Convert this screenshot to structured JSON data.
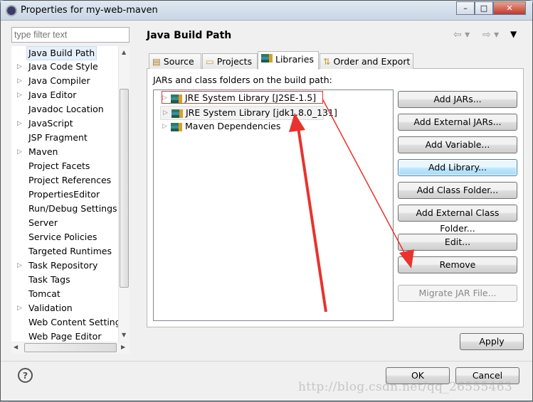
{
  "window": {
    "title": "Properties for my-web-maven",
    "minimize": "–",
    "maximize": "□",
    "close": "✕"
  },
  "sidebar": {
    "filter_placeholder": "type filter text",
    "items": [
      {
        "label": "Java Build Path",
        "expandable": false,
        "selected": true
      },
      {
        "label": "Java Code Style",
        "expandable": true
      },
      {
        "label": "Java Compiler",
        "expandable": true
      },
      {
        "label": "Java Editor",
        "expandable": true
      },
      {
        "label": "Javadoc Location",
        "expandable": false
      },
      {
        "label": "JavaScript",
        "expandable": true
      },
      {
        "label": "JSP Fragment",
        "expandable": false
      },
      {
        "label": "Maven",
        "expandable": true
      },
      {
        "label": "Project Facets",
        "expandable": false
      },
      {
        "label": "Project References",
        "expandable": false
      },
      {
        "label": "PropertiesEditor",
        "expandable": false
      },
      {
        "label": "Run/Debug Settings",
        "expandable": false
      },
      {
        "label": "Server",
        "expandable": false
      },
      {
        "label": "Service Policies",
        "expandable": false
      },
      {
        "label": "Targeted Runtimes",
        "expandable": false
      },
      {
        "label": "Task Repository",
        "expandable": true
      },
      {
        "label": "Task Tags",
        "expandable": false
      },
      {
        "label": "Tomcat",
        "expandable": false
      },
      {
        "label": "Validation",
        "expandable": true
      },
      {
        "label": "Web Content Settings",
        "expandable": false
      },
      {
        "label": "Web Page Editor",
        "expandable": false
      }
    ]
  },
  "main": {
    "title": "Java Build Path",
    "tabs": [
      {
        "label": "Source"
      },
      {
        "label": "Projects"
      },
      {
        "label": "Libraries",
        "active": true
      },
      {
        "label": "Order and Export"
      }
    ],
    "list_label": "JARs and class folders on the build path:",
    "entries": [
      {
        "label": "JRE System Library [J2SE-1.5]",
        "highlighted_red": true
      },
      {
        "label": "JRE System Library [jdk1.8.0_131]",
        "selected": true
      },
      {
        "label": "Maven Dependencies"
      }
    ],
    "buttons": {
      "add_jars": "Add JARs...",
      "add_external_jars": "Add External JARs...",
      "add_variable": "Add Variable...",
      "add_library": "Add Library...",
      "add_class_folder": "Add Class Folder...",
      "add_external_class_folder": "Add External Class Folder...",
      "edit": "Edit...",
      "remove": "Remove",
      "migrate_jar": "Migrate JAR File..."
    },
    "apply": "Apply"
  },
  "footer": {
    "ok": "OK",
    "cancel": "Cancel",
    "help_icon": "?"
  },
  "watermark": "http://blog.csdn.net/qq_26555463",
  "colors": {
    "annotation_red": "#e8332f",
    "focus_blue": "#3c7fb1"
  }
}
